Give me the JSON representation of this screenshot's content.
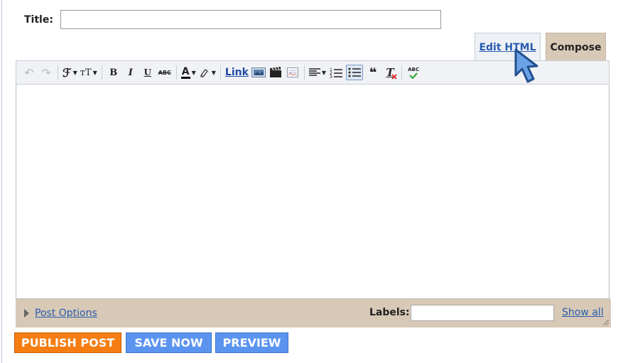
{
  "title_field": {
    "label": "Title:",
    "value": ""
  },
  "tabs": {
    "edit_html": "Edit HTML",
    "compose": "Compose"
  },
  "toolbar": {
    "link_label": "Link",
    "items": [
      "undo-icon",
      "redo-icon",
      "font-family-icon",
      "font-size-icon",
      "bold-icon",
      "italic-icon",
      "underline-icon",
      "strikethrough-icon",
      "text-color-icon",
      "highlight-icon",
      "link",
      "image-icon",
      "video-icon",
      "jump-break-icon",
      "align-icon",
      "numbered-list-icon",
      "bulleted-list-icon",
      "quote-icon",
      "remove-formatting-icon",
      "spellcheck-icon"
    ]
  },
  "glyphs": {
    "undo": "↶",
    "redo": "↷",
    "font_family": "ℱ",
    "font_size": "тT",
    "bold": "B",
    "italic": "I",
    "underline": "U",
    "strike": "ABC",
    "text_color": "A",
    "dropdown": "▼",
    "quote": "❝",
    "clear_format": "T",
    "spell": "ABC"
  },
  "editor": {
    "body": ""
  },
  "footer": {
    "post_options": "Post Options",
    "labels_label": "Labels:",
    "labels_value": "",
    "show_all": "Show all"
  },
  "buttons": {
    "publish": "PUBLISH POST",
    "save": "SAVE NOW",
    "preview": "PREVIEW"
  },
  "colors": {
    "publish": "#f57d12",
    "save": "#5b94ef",
    "footer_bar": "#d7c9b6",
    "link": "#2a5db0"
  }
}
